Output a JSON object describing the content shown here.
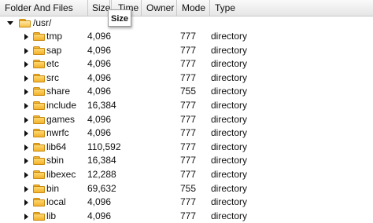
{
  "columns": {
    "name": "Folder And Files",
    "size": "Size",
    "time": "Time",
    "owner": "Owner",
    "mode": "Mode",
    "type": "Type"
  },
  "tooltip": "Size",
  "root": {
    "name": "/usr/"
  },
  "entries": [
    {
      "name": "tmp",
      "size": "4,096",
      "mode": "777",
      "type": "directory"
    },
    {
      "name": "sap",
      "size": "4,096",
      "mode": "777",
      "type": "directory"
    },
    {
      "name": "etc",
      "size": "4,096",
      "mode": "777",
      "type": "directory"
    },
    {
      "name": "src",
      "size": "4,096",
      "mode": "777",
      "type": "directory"
    },
    {
      "name": "share",
      "size": "4,096",
      "mode": "755",
      "type": "directory"
    },
    {
      "name": "include",
      "size": "16,384",
      "mode": "777",
      "type": "directory"
    },
    {
      "name": "games",
      "size": "4,096",
      "mode": "777",
      "type": "directory"
    },
    {
      "name": "nwrfc",
      "size": "4,096",
      "mode": "777",
      "type": "directory"
    },
    {
      "name": "lib64",
      "size": "110,592",
      "mode": "777",
      "type": "directory"
    },
    {
      "name": "sbin",
      "size": "16,384",
      "mode": "777",
      "type": "directory"
    },
    {
      "name": "libexec",
      "size": "12,288",
      "mode": "777",
      "type": "directory"
    },
    {
      "name": "bin",
      "size": "69,632",
      "mode": "755",
      "type": "directory"
    },
    {
      "name": "local",
      "size": "4,096",
      "mode": "777",
      "type": "directory"
    },
    {
      "name": "lib",
      "size": "4,096",
      "mode": "777",
      "type": "directory"
    }
  ]
}
